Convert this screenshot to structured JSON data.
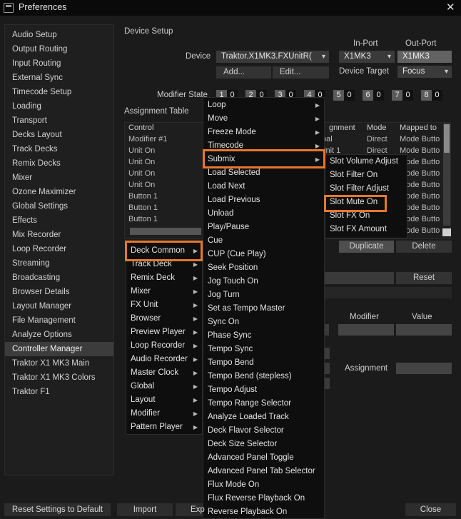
{
  "window": {
    "title": "Preferences"
  },
  "sidebar": {
    "items": [
      "Audio Setup",
      "Output Routing",
      "Input Routing",
      "External Sync",
      "Timecode Setup",
      "Loading",
      "Transport",
      "Decks Layout",
      "Track Decks",
      "Remix Decks",
      "Mixer",
      "Ozone Maximizer",
      "Global Settings",
      "Effects",
      "Mix Recorder",
      "Loop Recorder",
      "Streaming",
      "Broadcasting",
      "Browser Details",
      "Layout Manager",
      "File Management",
      "Analyze Options",
      "Controller Manager",
      "Traktor X1 MK3 Main",
      "Traktor X1 MK3 Colors",
      "Traktor F1"
    ],
    "selected": "Controller Manager"
  },
  "device_setup": {
    "heading": "Device Setup",
    "device_label": "Device",
    "device_value": "Traktor.X1MK3.FXUnitR(",
    "in_port_label": "In-Port",
    "out_port_label": "Out-Port",
    "in_port_value": "X1MK3",
    "out_port_value": "X1MK3",
    "add_label": "Add...",
    "edit_label": "Edit...",
    "device_target_label": "Device Target",
    "device_target_value": "Focus",
    "modifier_state_label": "Modifier State",
    "modifier_state": [
      {
        "k": "1",
        "v": "0"
      },
      {
        "k": "2",
        "v": "0"
      },
      {
        "k": "3",
        "v": "0"
      },
      {
        "k": "4",
        "v": "0"
      },
      {
        "k": "5",
        "v": "0"
      },
      {
        "k": "6",
        "v": "0"
      },
      {
        "k": "7",
        "v": "0"
      },
      {
        "k": "8",
        "v": "0"
      }
    ]
  },
  "assignment_table": {
    "heading": "Assignment Table",
    "col_control": "Control",
    "col_assignment": "gnment",
    "col_mode": "Mode",
    "col_mapped": "Mapped to",
    "controls": [
      "Modifier #1",
      "Unit On",
      "Unit On",
      "Unit On",
      "Unit On",
      "Button 1",
      "Button 1",
      "Button 1"
    ],
    "assign_vals": [
      "bal",
      "Jnit 1"
    ],
    "mode_vals": [
      "Direct",
      "Direct"
    ],
    "mapped_vals": [
      "Mode Butto",
      "Mode Butto",
      "Mode Butto",
      "Mode Butto",
      "Mode Butto",
      "Mode Butto",
      "Mode Butto",
      "Mode Butto",
      "Mode Butto"
    ],
    "duplicate_label": "Duplicate",
    "delete_label": "Delete",
    "reset_label": "Reset",
    "modifier_label": "Modifier",
    "value_label": "Value",
    "assignment_label": "Assignment"
  },
  "menu_level1": {
    "items": [
      "Deck Common",
      "Track Deck",
      "Remix Deck",
      "Mixer",
      "FX Unit",
      "Browser",
      "Preview Player",
      "Loop Recorder",
      "Audio Recorder",
      "Master Clock",
      "Global",
      "Layout",
      "Modifier",
      "Pattern Player"
    ],
    "highlighted": "Deck Common"
  },
  "menu_level2": {
    "items": [
      "Loop",
      "Move",
      "Freeze Mode",
      "Timecode",
      "Submix",
      "Load Selected",
      "Load Next",
      "Load Previous",
      "Unload",
      "Play/Pause",
      "Cue",
      "CUP (Cue Play)",
      "Seek Position",
      "Jog Touch On",
      "Jog Turn",
      "Set as Tempo Master",
      "Sync On",
      "Phase Sync",
      "Tempo Sync",
      "Tempo Bend",
      "Tempo Bend (stepless)",
      "Tempo Adjust",
      "Tempo Range Selector",
      "Analyze Loaded Track",
      "Deck Flavor Selector",
      "Deck Size Selector",
      "Advanced Panel Toggle",
      "Advanced Panel Tab Selector",
      "Flux Mode On",
      "Flux Reverse Playback On",
      "Reverse Playback On"
    ],
    "highlighted": "Submix"
  },
  "menu_level3": {
    "items": [
      "Slot Volume Adjust",
      "Slot Filter On",
      "Slot Filter Adjust",
      "Slot Mute On",
      "Slot FX On",
      "Slot FX Amount"
    ],
    "highlighted": "Slot Mute On"
  },
  "footer": {
    "reset_label": "Reset Settings to Default",
    "import_label": "Import",
    "export_label": "Exp",
    "close_label": "Close"
  },
  "colors": {
    "highlight": "#e8772a",
    "background": "#1b1b1b",
    "titlebar": "#0a0a0a"
  }
}
